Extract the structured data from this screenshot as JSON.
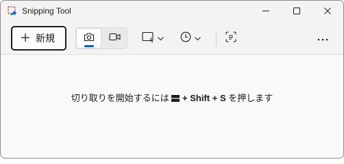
{
  "window": {
    "title": "Snipping Tool"
  },
  "icons": {
    "app": "snipping-tool-icon",
    "minimize": "minimize-icon",
    "maximize": "maximize-icon",
    "close": "close-icon",
    "new": "plus-icon",
    "snip_mode": "camera-icon",
    "record_mode": "video-camera-icon",
    "shape": "rectangle-snip-icon",
    "delay": "clock-icon",
    "text_actions": "text-actions-icon",
    "more": "more-icon",
    "windows_key": "windows-logo-icon"
  },
  "toolbar": {
    "new_label": "新規"
  },
  "hint": {
    "prefix": "切り取りを開始するには",
    "plus1": "+",
    "shift": "Shift",
    "plus2": "+",
    "s": "S",
    "suffix": "を押します"
  },
  "colors": {
    "accent": "#005fb8",
    "background": "#f9f9f9",
    "toolbar": "#f3f3f3"
  }
}
